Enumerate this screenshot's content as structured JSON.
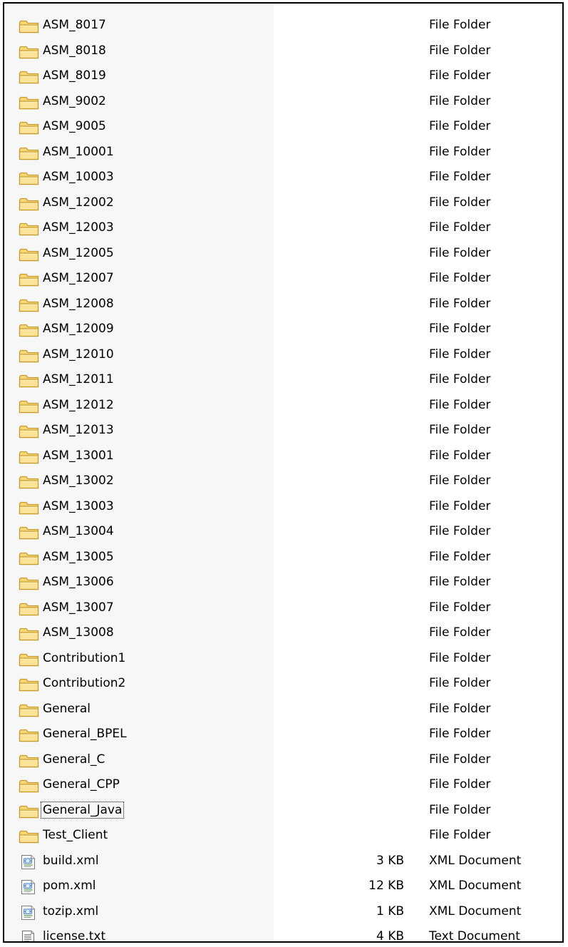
{
  "file_list": {
    "items": [
      {
        "name": "ASM_8017",
        "size": "",
        "type": "File Folder",
        "icon": "folder-icon"
      },
      {
        "name": "ASM_8018",
        "size": "",
        "type": "File Folder",
        "icon": "folder-icon"
      },
      {
        "name": "ASM_8019",
        "size": "",
        "type": "File Folder",
        "icon": "folder-icon"
      },
      {
        "name": "ASM_9002",
        "size": "",
        "type": "File Folder",
        "icon": "folder-icon"
      },
      {
        "name": "ASM_9005",
        "size": "",
        "type": "File Folder",
        "icon": "folder-icon"
      },
      {
        "name": "ASM_10001",
        "size": "",
        "type": "File Folder",
        "icon": "folder-icon"
      },
      {
        "name": "ASM_10003",
        "size": "",
        "type": "File Folder",
        "icon": "folder-icon"
      },
      {
        "name": "ASM_12002",
        "size": "",
        "type": "File Folder",
        "icon": "folder-icon"
      },
      {
        "name": "ASM_12003",
        "size": "",
        "type": "File Folder",
        "icon": "folder-icon"
      },
      {
        "name": "ASM_12005",
        "size": "",
        "type": "File Folder",
        "icon": "folder-icon"
      },
      {
        "name": "ASM_12007",
        "size": "",
        "type": "File Folder",
        "icon": "folder-icon"
      },
      {
        "name": "ASM_12008",
        "size": "",
        "type": "File Folder",
        "icon": "folder-icon"
      },
      {
        "name": "ASM_12009",
        "size": "",
        "type": "File Folder",
        "icon": "folder-icon"
      },
      {
        "name": "ASM_12010",
        "size": "",
        "type": "File Folder",
        "icon": "folder-icon"
      },
      {
        "name": "ASM_12011",
        "size": "",
        "type": "File Folder",
        "icon": "folder-icon"
      },
      {
        "name": "ASM_12012",
        "size": "",
        "type": "File Folder",
        "icon": "folder-icon"
      },
      {
        "name": "ASM_12013",
        "size": "",
        "type": "File Folder",
        "icon": "folder-icon"
      },
      {
        "name": "ASM_13001",
        "size": "",
        "type": "File Folder",
        "icon": "folder-icon"
      },
      {
        "name": "ASM_13002",
        "size": "",
        "type": "File Folder",
        "icon": "folder-icon"
      },
      {
        "name": "ASM_13003",
        "size": "",
        "type": "File Folder",
        "icon": "folder-icon"
      },
      {
        "name": "ASM_13004",
        "size": "",
        "type": "File Folder",
        "icon": "folder-icon"
      },
      {
        "name": "ASM_13005",
        "size": "",
        "type": "File Folder",
        "icon": "folder-icon"
      },
      {
        "name": "ASM_13006",
        "size": "",
        "type": "File Folder",
        "icon": "folder-icon"
      },
      {
        "name": "ASM_13007",
        "size": "",
        "type": "File Folder",
        "icon": "folder-icon"
      },
      {
        "name": "ASM_13008",
        "size": "",
        "type": "File Folder",
        "icon": "folder-icon"
      },
      {
        "name": "Contribution1",
        "size": "",
        "type": "File Folder",
        "icon": "folder-icon"
      },
      {
        "name": "Contribution2",
        "size": "",
        "type": "File Folder",
        "icon": "folder-icon"
      },
      {
        "name": "General",
        "size": "",
        "type": "File Folder",
        "icon": "folder-icon"
      },
      {
        "name": "General_BPEL",
        "size": "",
        "type": "File Folder",
        "icon": "folder-icon"
      },
      {
        "name": "General_C",
        "size": "",
        "type": "File Folder",
        "icon": "folder-icon"
      },
      {
        "name": "General_CPP",
        "size": "",
        "type": "File Folder",
        "icon": "folder-icon"
      },
      {
        "name": "General_Java",
        "size": "",
        "type": "File Folder",
        "icon": "folder-icon",
        "focused": true
      },
      {
        "name": "Test_Client",
        "size": "",
        "type": "File Folder",
        "icon": "folder-icon"
      },
      {
        "name": "build.xml",
        "size": "3 KB",
        "type": "XML Document",
        "icon": "xml-file-icon"
      },
      {
        "name": "pom.xml",
        "size": "12 KB",
        "type": "XML Document",
        "icon": "xml-file-icon"
      },
      {
        "name": "tozip.xml",
        "size": "1 KB",
        "type": "XML Document",
        "icon": "xml-file-icon"
      },
      {
        "name": "license.txt",
        "size": "4 KB",
        "type": "Text Document",
        "icon": "text-file-icon"
      }
    ]
  },
  "colors": {
    "folder_fill": "#f6d77a",
    "folder_stroke": "#c79a2a",
    "name_column_bg": "#f7f7f7",
    "border": "#000000"
  }
}
